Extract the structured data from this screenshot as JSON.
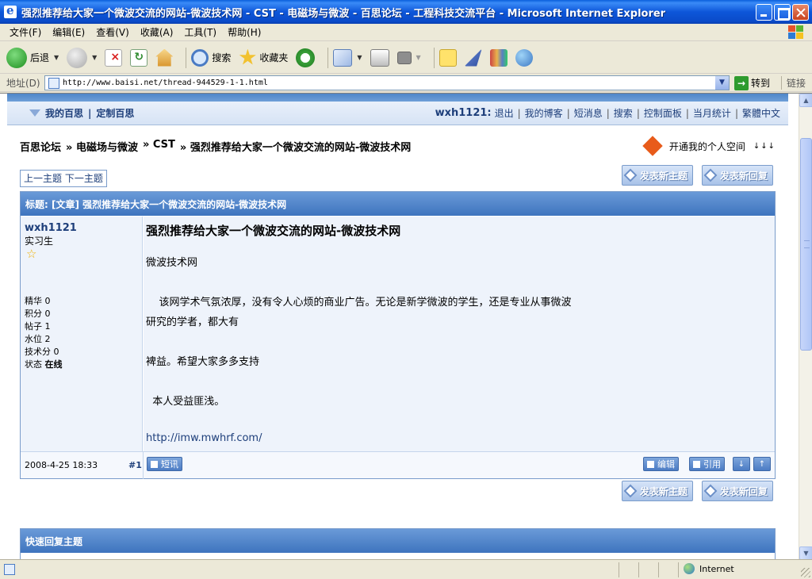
{
  "window": {
    "title": "强烈推荐给大家一个微波交流的网站-微波技术网 - CST - 电磁场与微波 - 百思论坛 - 工程科技交流平台 - Microsoft Internet Explorer"
  },
  "menu": [
    "文件(F)",
    "编辑(E)",
    "查看(V)",
    "收藏(A)",
    "工具(T)",
    "帮助(H)"
  ],
  "toolbar": {
    "back": "后退",
    "search": "搜索",
    "favorites": "收藏夹"
  },
  "address": {
    "label": "地址(D)",
    "url": "http://www.baisi.net/thread-944529-1-1.html",
    "go": "转到",
    "links": "链接"
  },
  "userbar": {
    "my_baisi": "我的百思",
    "custom": "定制百思",
    "username": "wxh1121:",
    "links": [
      "退出",
      "我的博客",
      "短消息",
      "搜索",
      "控制面板",
      "当月统计",
      "繁體中文"
    ]
  },
  "breadcrumb": {
    "items": [
      "百思论坛",
      "» 电磁场与微波",
      "» CST",
      "» 强烈推荐给大家一个微波交流的网站-微波技术网"
    ]
  },
  "space": {
    "label": "开通我的个人空间",
    "arrows": "↓↓↓"
  },
  "nav": {
    "prev_next": "上一主题 下一主题"
  },
  "buttons": {
    "new_thread": "发表新主题",
    "new_reply": "发表新回复"
  },
  "post": {
    "header": "标题: [文章] 强烈推荐给大家一个微波交流的网站-微波技术网",
    "author": "wxh1121",
    "rank": "实习生",
    "stats": [
      {
        "k": "精华",
        "v": "0"
      },
      {
        "k": "积分",
        "v": "0"
      },
      {
        "k": "帖子",
        "v": "1"
      },
      {
        "k": "水位",
        "v": "2"
      },
      {
        "k": "技术分",
        "v": "0"
      },
      {
        "k": "状态",
        "v": "在线"
      }
    ],
    "title": "强烈推荐给大家一个微波交流的网站-微波技术网",
    "lines": [
      "微波技术网",
      "    该网学术气氛浓厚，没有令人心烦的商业广告。无论是新学微波的学生，还是专业从事微波",
      "研究的学者，都大有",
      "裨益。希望大家多多支持",
      "  本人受益匪浅。"
    ],
    "link": "http://imw.mwhrf.com/",
    "date": "2008-4-25 18:33",
    "floor": "#1",
    "btn_sms": "短讯",
    "btn_edit": "编辑",
    "btn_quote": "引用"
  },
  "quick_reply": {
    "header": "快速回复主题"
  },
  "status": {
    "zone": "Internet"
  }
}
